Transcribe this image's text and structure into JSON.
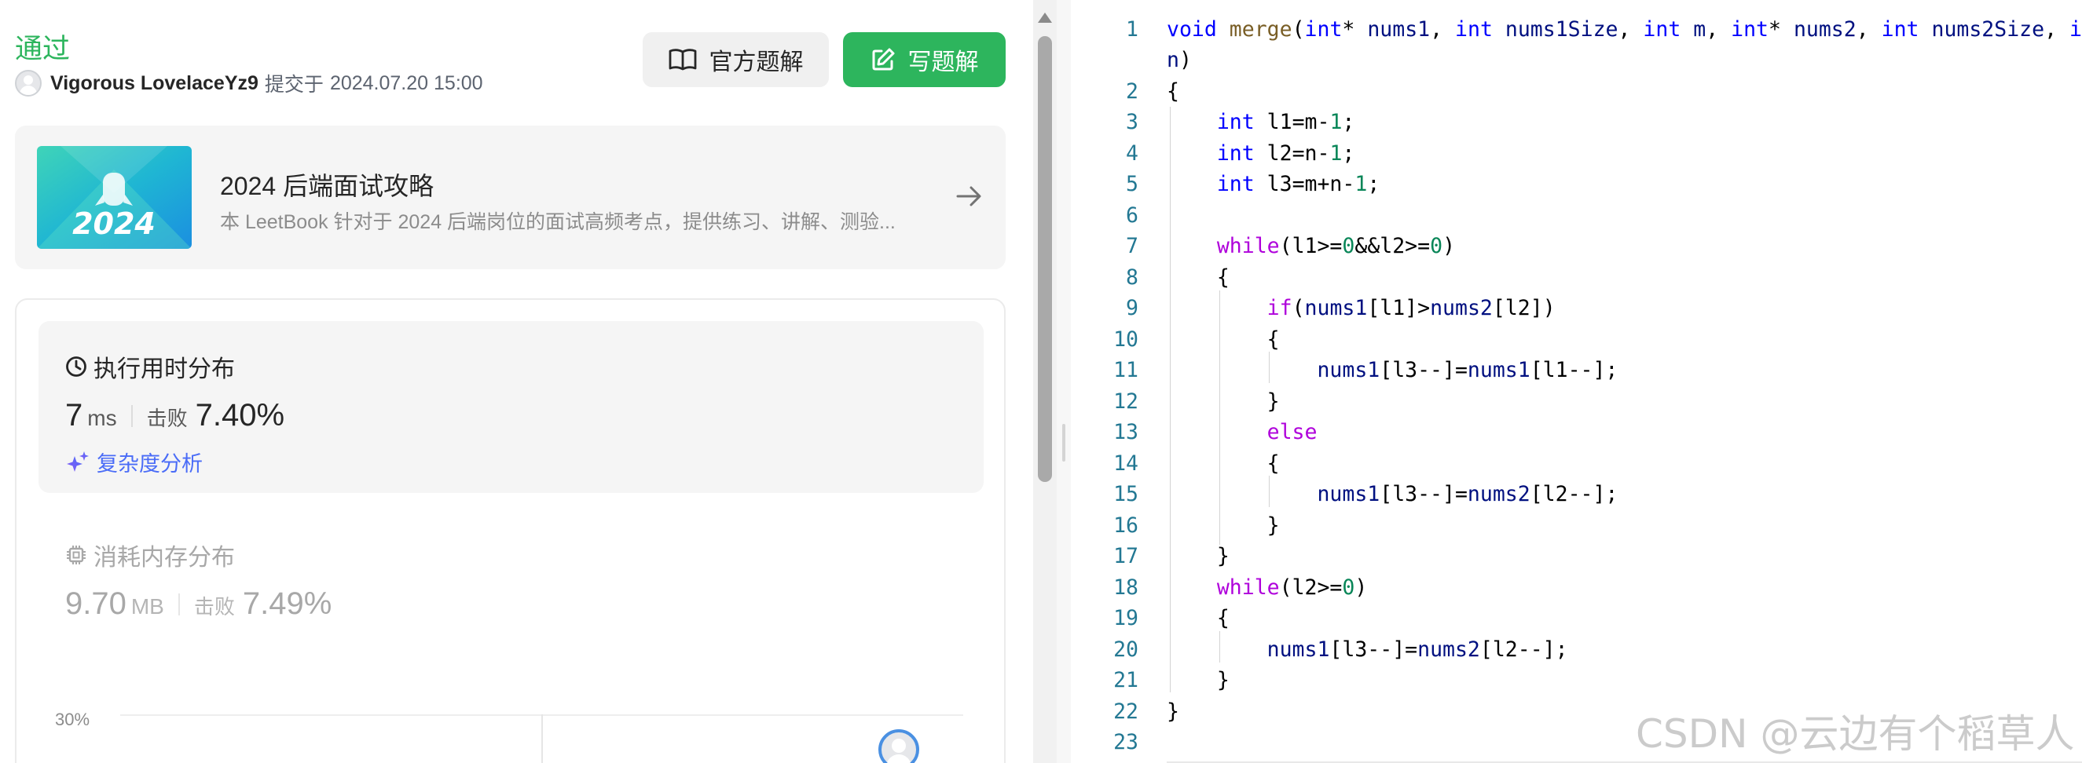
{
  "result": {
    "status": "通过",
    "username": "Vigorous LovelaceYz9",
    "submitted_label": "提交于",
    "submitted_time": "2024.07.20 15:00"
  },
  "buttons": {
    "official_solution": "官方题解",
    "write_solution": "写题解"
  },
  "leetbook": {
    "cover_text": "2024",
    "title": "2024 后端面试攻略",
    "description": "本 LeetBook 针对于 2024 后端岗位的面试高频考点，提供练习、讲解、测验..."
  },
  "runtime": {
    "title": "执行用时分布",
    "value": "7",
    "unit": "ms",
    "beat_label": "击败",
    "beat_percent": "7.40%",
    "complexity_link": "复杂度分析"
  },
  "memory": {
    "title": "消耗内存分布",
    "value": "9.70",
    "unit": "MB",
    "beat_label": "击败",
    "beat_percent": "7.49%"
  },
  "chart": {
    "y_tick": "30%"
  },
  "editor": {
    "line_numbers": [
      "1",
      "2",
      "3",
      "4",
      "5",
      "6",
      "7",
      "8",
      "9",
      "10",
      "11",
      "12",
      "13",
      "14",
      "15",
      "16",
      "17",
      "18",
      "19",
      "20",
      "21",
      "22",
      "23"
    ]
  },
  "watermark": "CSDN @云边有个稻草人",
  "colors": {
    "accent_green": "#2db55d",
    "link_blue": "#4a6cf7",
    "line_number": "#237893",
    "keyword": "#0000ff",
    "control": "#af00db",
    "number": "#098658"
  }
}
